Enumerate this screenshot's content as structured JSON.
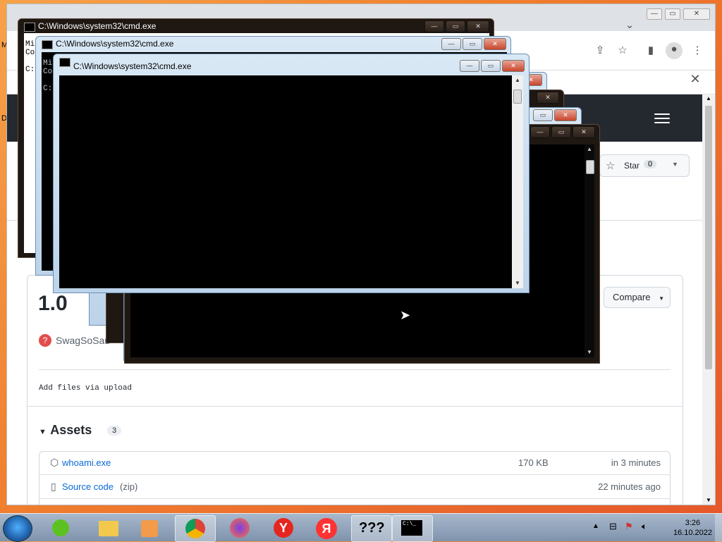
{
  "cmd": {
    "title": "C:\\Windows\\system32\\cmd.exe",
    "lines": [
      "Mi",
      "Co",
      "C:"
    ]
  },
  "github": {
    "star_label": "Star",
    "star_count": "0",
    "compare_label": "Compare",
    "release_title": "1.0",
    "author": "SwagSoSau",
    "commit_message": "Add files via upload",
    "assets_heading": "Assets",
    "assets_count": "3",
    "assets": [
      {
        "name": "whoami.exe",
        "size": "170 KB",
        "time": "in 3 minutes"
      },
      {
        "name": "Source code",
        "suffix": "(zip)",
        "size": "",
        "time": "22 minutes ago"
      }
    ]
  },
  "taskbar": {
    "time": "3:26",
    "date": "16.10.2022",
    "qq_label": "???",
    "yandex_letter": "Я",
    "yandex_browser_letter": "Y",
    "cmd_label": "C:\\_"
  },
  "desktop_letters": {
    "m": "M",
    "d": "D"
  },
  "colors": {
    "accent": "#0969da",
    "header": "#24292f",
    "console": "#000000"
  }
}
